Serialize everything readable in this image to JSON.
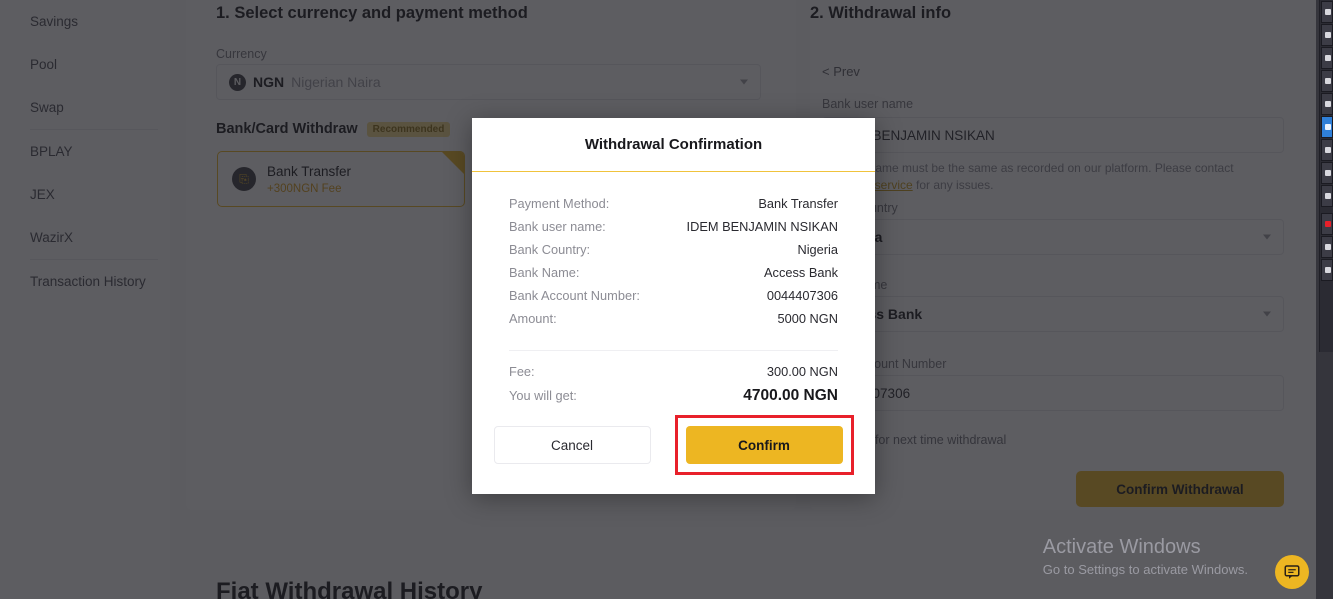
{
  "sidebar": {
    "items": [
      {
        "label": "Savings",
        "divider_after": false
      },
      {
        "label": "Pool",
        "divider_after": false
      },
      {
        "label": "Swap",
        "divider_after": true
      },
      {
        "label": "BPLAY",
        "divider_after": false
      },
      {
        "label": "JEX",
        "divider_after": false
      },
      {
        "label": "WazirX",
        "divider_after": true
      },
      {
        "label": "Transaction History",
        "divider_after": false
      }
    ]
  },
  "step1": {
    "title": "1. Select currency and payment method",
    "currency_label": "Currency",
    "currency_code": "NGN",
    "currency_name": "Nigerian Naira",
    "currency_icon": "ngn-coin-icon",
    "method_group_label": "Bank/Card Withdraw",
    "recommended_badge": "Recommended",
    "method_name": "Bank Transfer",
    "method_fee": "+300NGN Fee"
  },
  "step2": {
    "title": "2. Withdrawal info",
    "prev_link": "< Prev",
    "bank_user_name_label": "Bank user name",
    "bank_user_name_value": "IDEM BENJAMIN NSIKAN",
    "hint_text_before": "Account name must be the same as recorded on our platform. Please contact ",
    "hint_link": "customer service",
    "hint_text_after": " for any issues.",
    "bank_country_label": "Bank Country",
    "bank_country_value": "Nigeria",
    "bank_name_label": "Bank Name",
    "bank_name_value": "Access Bank",
    "bank_account_number_label": "Bank Account Number",
    "bank_account_number_value": "0044407306",
    "save_checkbox_label": "Save for next time withdrawal",
    "confirm_withdrawal_label": "Confirm Withdrawal"
  },
  "history": {
    "title": "Fiat Withdrawal History"
  },
  "modal": {
    "title": "Withdrawal Confirmation",
    "rows": [
      {
        "label": "Payment Method:",
        "value": "Bank Transfer"
      },
      {
        "label": "Bank user name:",
        "value": "IDEM BENJAMIN NSIKAN"
      },
      {
        "label": "Bank Country:",
        "value": "Nigeria"
      },
      {
        "label": "Bank Name:",
        "value": "Access Bank"
      },
      {
        "label": "Bank Account Number:",
        "value": "0044407306"
      },
      {
        "label": "Amount:",
        "value": "5000 NGN"
      }
    ],
    "fee_label": "Fee:",
    "fee_value": "300.00 NGN",
    "total_label": "You will get:",
    "total_value": "4700.00 NGN",
    "cancel_label": "Cancel",
    "confirm_label": "Confirm",
    "highlight_color": "#e8202a",
    "accent_color": "#edb622"
  },
  "watermark": {
    "title": "Activate Windows",
    "subtitle": "Go to Settings to activate Windows."
  },
  "chat": {
    "icon": "chat-bubble-icon"
  },
  "taskbar": {
    "icons": [
      {
        "name": "app-icon-1",
        "state": "normal"
      },
      {
        "name": "app-icon-2",
        "state": "normal"
      },
      {
        "name": "app-icon-3",
        "state": "normal"
      },
      {
        "name": "app-icon-4",
        "state": "normal"
      },
      {
        "name": "app-icon-5",
        "state": "normal"
      },
      {
        "name": "app-icon-active",
        "state": "active"
      },
      {
        "name": "app-icon-6",
        "state": "normal"
      },
      {
        "name": "app-icon-7",
        "state": "normal"
      },
      {
        "name": "app-icon-8",
        "state": "normal"
      },
      {
        "name": "app-icon-record",
        "state": "record"
      },
      {
        "name": "app-icon-9",
        "state": "normal"
      },
      {
        "name": "app-icon-10",
        "state": "normal"
      }
    ]
  }
}
